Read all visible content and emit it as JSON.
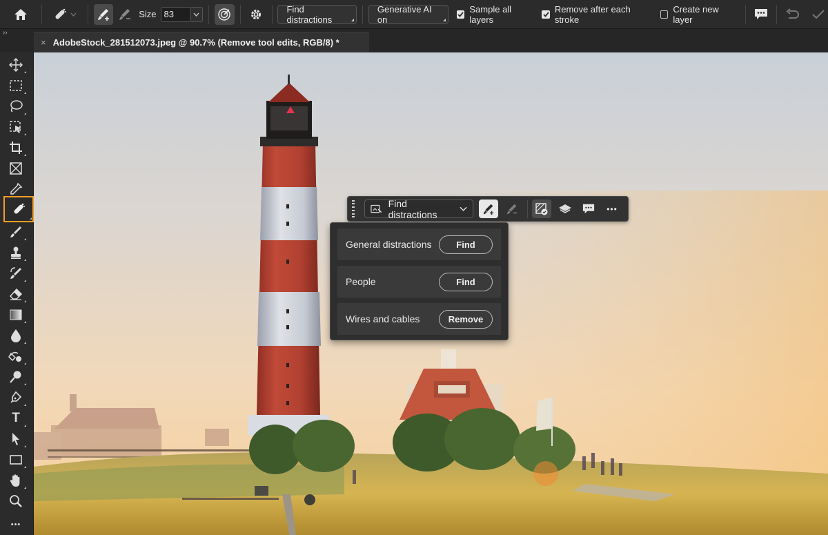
{
  "options_bar": {
    "size_label": "Size",
    "size_value": "83",
    "find_distractions_label": "Find distractions",
    "generative_ai_label": "Generative AI on",
    "sample_all_layers_label": "Sample all layers",
    "sample_all_layers_checked": true,
    "remove_after_stroke_label": "Remove after each stroke",
    "remove_after_stroke_checked": true,
    "create_new_layer_label": "Create new layer",
    "create_new_layer_checked": false
  },
  "document_tab": {
    "close_glyph": "×",
    "title": "AdobeStock_281512073.jpeg @ 90.7% (Remove tool edits, RGB/8) *"
  },
  "toolbar": {
    "collapse_glyph": "››",
    "tools": [
      "move-tool",
      "marquee-tool",
      "lasso-tool",
      "object-select-tool",
      "crop-tool",
      "frame-tool",
      "eyedropper-tool",
      "remove-tool",
      "brush-tool",
      "clone-stamp-tool",
      "history-brush-tool",
      "eraser-tool",
      "gradient-tool",
      "blur-tool",
      "dodge-tool",
      "burn-tool",
      "pen-tool",
      "type-tool",
      "path-select-tool",
      "rectangle-tool",
      "hand-tool",
      "zoom-tool",
      "more-tools"
    ],
    "type_glyph": "T",
    "more_glyph": "•••"
  },
  "context_bar": {
    "dropdown_label": "Find distractions",
    "more_glyph": "•••"
  },
  "distractions_panel": {
    "rows": [
      {
        "label": "General distractions",
        "action": "Find"
      },
      {
        "label": "People",
        "action": "Find"
      },
      {
        "label": "Wires and cables",
        "action": "Remove"
      }
    ]
  },
  "colors": {
    "accent_selected_tool": "#f29d26",
    "ui_dark": "#2b2b2b"
  }
}
